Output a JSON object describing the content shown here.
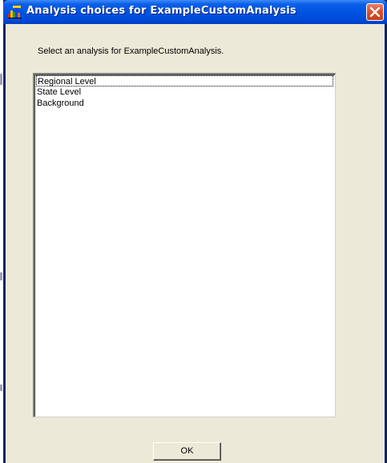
{
  "window": {
    "title": "Analysis choices for ExampleCustomAnalysis",
    "title_icon": "chart-icon",
    "close_icon": "close-icon"
  },
  "dialog": {
    "prompt": "Select an analysis for ExampleCustomAnalysis.",
    "list_items": [
      {
        "label": "Regional Level",
        "focused": true
      },
      {
        "label": "State Level",
        "focused": false
      },
      {
        "label": "Background",
        "focused": false
      }
    ],
    "ok_label": "OK"
  },
  "colors": {
    "titlebar": "#0054e3",
    "client_bg": "#ece9d8",
    "close_button": "#d9532e"
  }
}
